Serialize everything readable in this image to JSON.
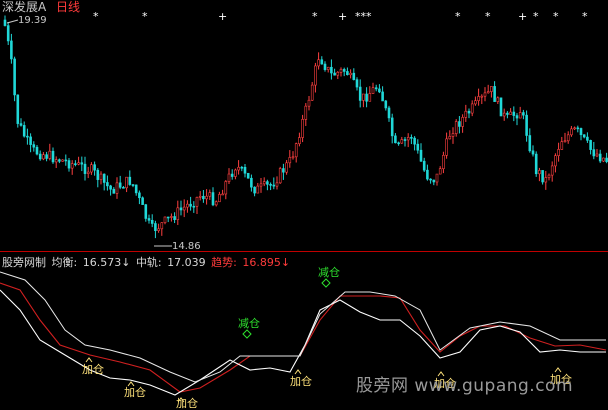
{
  "header": {
    "stock_name": "深发展A",
    "period": "日线"
  },
  "price_labels": {
    "high": "19.39",
    "low": "14.86"
  },
  "indicator": {
    "name": "股旁网制",
    "mean_label": "均衡:",
    "mean_value": "16.573↓",
    "mid_label": "中轨:",
    "mid_value": "17.039",
    "trend_label": "趋势:",
    "trend_value": "16.895↓"
  },
  "signals": {
    "reduce_1": "减仓",
    "reduce_2": "减仓",
    "add_1": "加仓",
    "add_2": "加仓",
    "add_3": "加仓",
    "add_4": "加仓",
    "add_5": "加仓",
    "add_6": "加仓"
  },
  "watermark": "股旁网 www.gupang.com",
  "colors": {
    "background": "#000000",
    "up": "#ff4040",
    "down": "#20d8d8",
    "white_line": "#ffffff",
    "red_line": "#d02020",
    "divider": "#c00000"
  },
  "top_markers": [
    "*",
    "*",
    "+",
    "*",
    "+",
    "***",
    "*",
    "*",
    "+",
    "*",
    "*",
    "*"
  ]
}
